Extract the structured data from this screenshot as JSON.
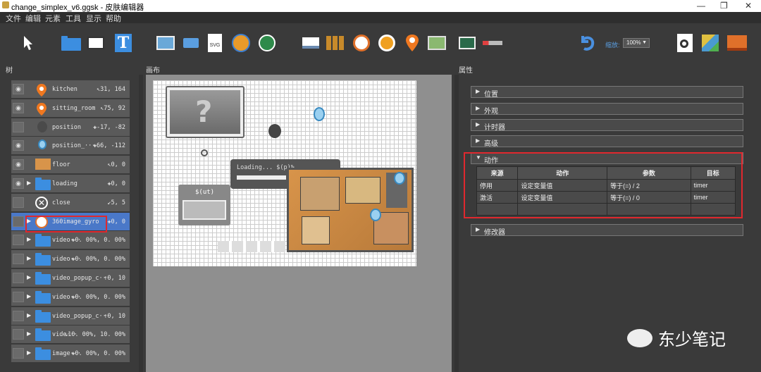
{
  "window": {
    "title": "change_simplex_v6.ggsk - 皮肤编辑器",
    "minimize": "—",
    "maximize": "❐",
    "close": "✕"
  },
  "menu": [
    "文件",
    "编辑",
    "元素",
    "工具",
    "显示",
    "帮助"
  ],
  "toolbar": {
    "zoom_label": "缩放:",
    "zoom_value": "100%"
  },
  "panels": {
    "tree": "树",
    "canvas": "画布",
    "properties": "属性"
  },
  "tree": [
    {
      "name": "kitchen",
      "coord": "↖31, 164",
      "icon": "pin-icon",
      "eye": true
    },
    {
      "name": "sitting_room",
      "coord": "↖75, 92",
      "icon": "pin-icon",
      "eye": true
    },
    {
      "name": "position",
      "coord": "✚-17, -82",
      "icon": "ball-icon",
      "eye": false
    },
    {
      "name": "position_···",
      "coord": "✚66, -112",
      "icon": "location-icon",
      "eye": true
    },
    {
      "name": "floor",
      "coord": "↖0, 0",
      "icon": "floorplan-icon",
      "eye": true
    },
    {
      "name": "loading",
      "coord": "✚0, 0",
      "icon": "folder-icon",
      "eye": true,
      "arrow": true
    },
    {
      "name": "close",
      "coord": "↙5, 5",
      "icon": "close-circle-icon",
      "eye": false
    },
    {
      "name": "360image_gyro",
      "coord": "✚0, 0",
      "icon": "gyro-icon",
      "eye": false,
      "arrow": true,
      "selected": true
    },
    {
      "name": "video···",
      "coord": "✚0. 00%, 0. 00%",
      "icon": "folder-icon",
      "eye": false,
      "arrow": true
    },
    {
      "name": "video···",
      "coord": "✚0. 00%, 0. 00%",
      "icon": "folder-icon",
      "eye": false,
      "arrow": true
    },
    {
      "name": "video_popup_c···",
      "coord": "↑0, 10",
      "icon": "folder-icon",
      "eye": false,
      "arrow": true
    },
    {
      "name": "video···",
      "coord": "✚0. 00%, 0. 00%",
      "icon": "folder-icon",
      "eye": false,
      "arrow": true
    },
    {
      "name": "video_popup_c···",
      "coord": "↑0, 10",
      "icon": "folder-icon",
      "eye": false,
      "arrow": true
    },
    {
      "name": "vide···",
      "coord": "↘10. 00%, 10. 00%",
      "icon": "folder-icon",
      "eye": false,
      "arrow": true
    },
    {
      "name": "image···",
      "coord": "✚0. 00%, 0. 00%",
      "icon": "folder-icon",
      "eye": false,
      "arrow": true
    }
  ],
  "canvas": {
    "loading_text": "Loading... $(p)%",
    "ut_text": "$(ut)"
  },
  "props": {
    "sections": [
      "位置",
      "外观",
      "计时器",
      "高级"
    ],
    "action_section": "动作",
    "modifier_section": "修改器",
    "columns": [
      "来源",
      "动作",
      "参数",
      "目标"
    ],
    "rows": [
      {
        "source": "停用",
        "action": "设定变量值",
        "param": "等于(=) / 2",
        "target": "timer"
      },
      {
        "source": "激活",
        "action": "设定变量值",
        "param": "等于(=) / 0",
        "target": "timer"
      },
      {
        "source": "",
        "action": "",
        "param": "",
        "target": ""
      }
    ]
  },
  "watermark": "东少笔记",
  "colors": {
    "selection": "#4a78c8",
    "highlight": "#e0282e",
    "folder": "#3c8ee0"
  }
}
